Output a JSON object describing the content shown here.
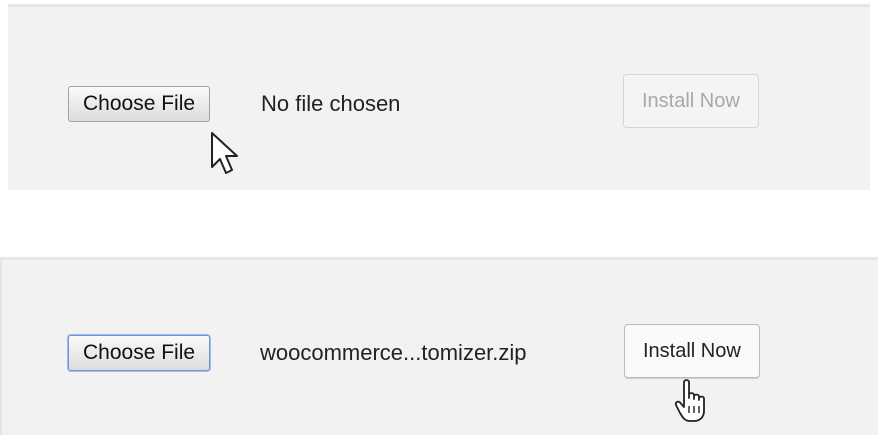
{
  "before": {
    "choose_file_label": "Choose File",
    "file_status": "No file chosen",
    "install_label": "Install Now",
    "install_enabled": false,
    "cursor": "arrow-cursor-icon"
  },
  "after": {
    "choose_file_label": "Choose File",
    "file_status": "woocommerce...tomizer.zip",
    "install_label": "Install Now",
    "install_enabled": true,
    "cursor": "hand-pointer-cursor-icon"
  },
  "colors": {
    "panel_bg": "#f2f2f2",
    "focus_ring": "#6f97d6",
    "disabled_text": "#a8a8a8"
  }
}
